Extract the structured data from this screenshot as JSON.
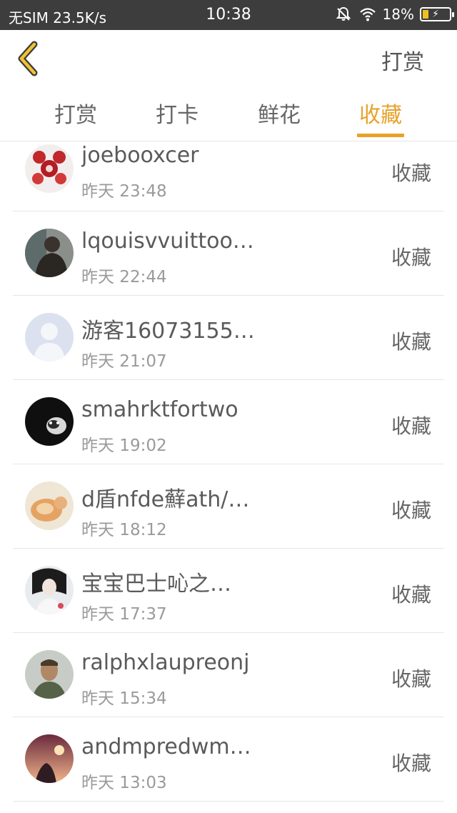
{
  "status_bar": {
    "carrier": "无SIM 23.5K/s",
    "time": "10:38",
    "battery": "18%",
    "icons": [
      "bell-muted-icon",
      "wifi-icon",
      "battery-charging-icon"
    ]
  },
  "header": {
    "back_icon": "chevron-left-icon",
    "action_label": "打赏"
  },
  "tabs": [
    {
      "label": "打赏"
    },
    {
      "label": "打卡"
    },
    {
      "label": "鲜花"
    },
    {
      "label": "收藏",
      "active": true
    }
  ],
  "accent_color": "#e8a22a",
  "list": [
    {
      "name": "joebooxcer",
      "time": "昨天 23:48",
      "action": "收藏",
      "avatar": "red-pattern-avatar"
    },
    {
      "name": "lqouisvvuittoo…",
      "time": "昨天 22:44",
      "action": "收藏",
      "avatar": "dark-figure-avatar"
    },
    {
      "name": "游客16073155…",
      "time": "昨天 21:07",
      "action": "收藏",
      "avatar": "default-avatar"
    },
    {
      "name": "smahrktfortwo",
      "time": "昨天 19:02",
      "action": "收藏",
      "avatar": "black-cat-avatar"
    },
    {
      "name": "d盾nfde蘚ath/…",
      "time": "昨天 18:12",
      "action": "收藏",
      "avatar": "orange-cat-avatar"
    },
    {
      "name": "宝宝巴士吣之…",
      "time": "昨天 17:37",
      "action": "收藏",
      "avatar": "girl-avatar"
    },
    {
      "name": "ralphxlaupreonj",
      "time": "昨天 15:34",
      "action": "收藏",
      "avatar": "soldier-avatar"
    },
    {
      "name": "andmpredwm…",
      "time": "昨天 13:03",
      "action": "收藏",
      "avatar": "sunset-avatar"
    }
  ]
}
